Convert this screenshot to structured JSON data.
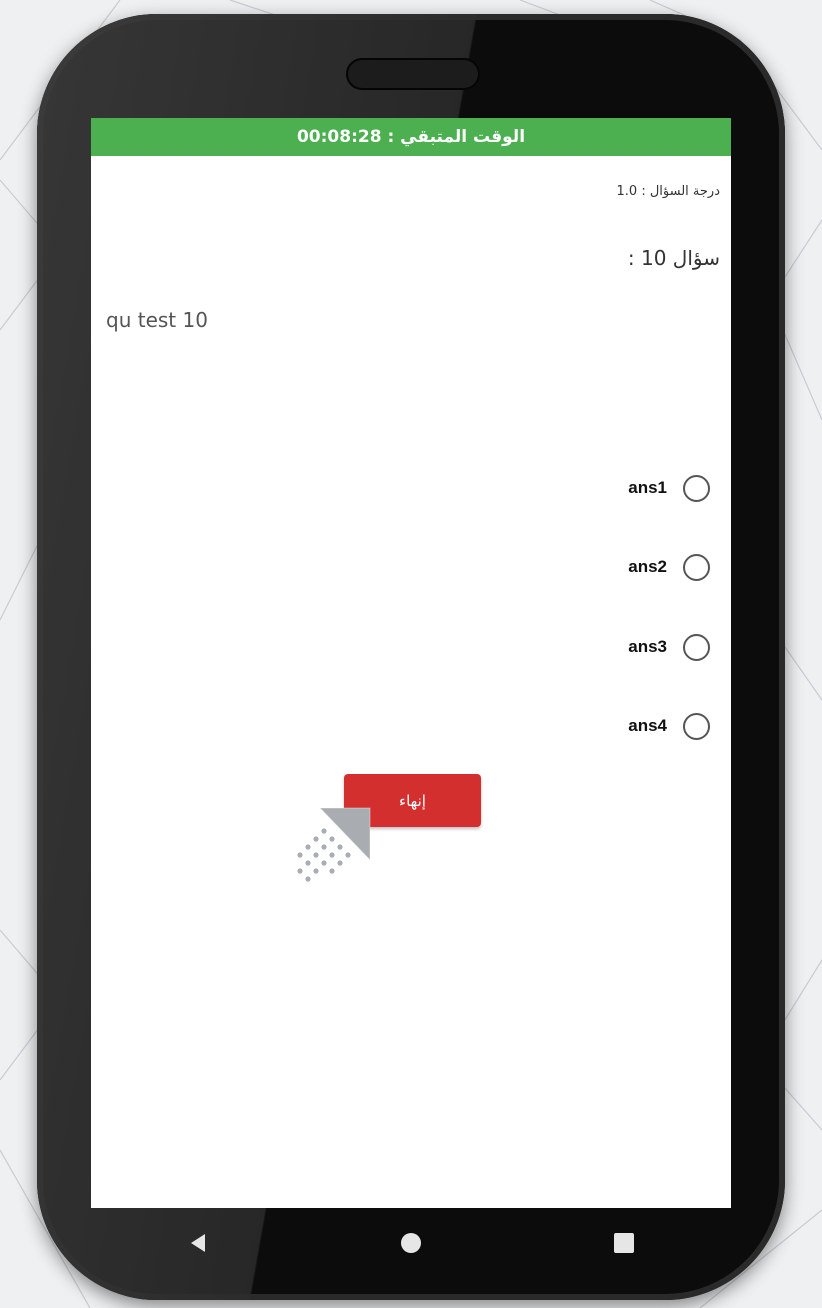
{
  "timer": {
    "text": "الوقت المتبقي : 00:08:28"
  },
  "question": {
    "grade_text": "درجة السؤال : 1.0",
    "number_text": "سؤال 10 :",
    "body_text": "qu test 10"
  },
  "options": [
    {
      "label": "ans1",
      "selected": false
    },
    {
      "label": "ans2",
      "selected": false
    },
    {
      "label": "ans3",
      "selected": false
    },
    {
      "label": "ans4",
      "selected": false
    }
  ],
  "finish_button": {
    "label": "إنهاء"
  },
  "colors": {
    "timer_bar": "#4caf50",
    "finish_button": "#d32f2f",
    "phone_body": "#0c0c0c"
  },
  "nav": {
    "back_icon": "back-triangle-icon",
    "home_icon": "home-circle-icon",
    "recent_icon": "recent-square-icon"
  }
}
